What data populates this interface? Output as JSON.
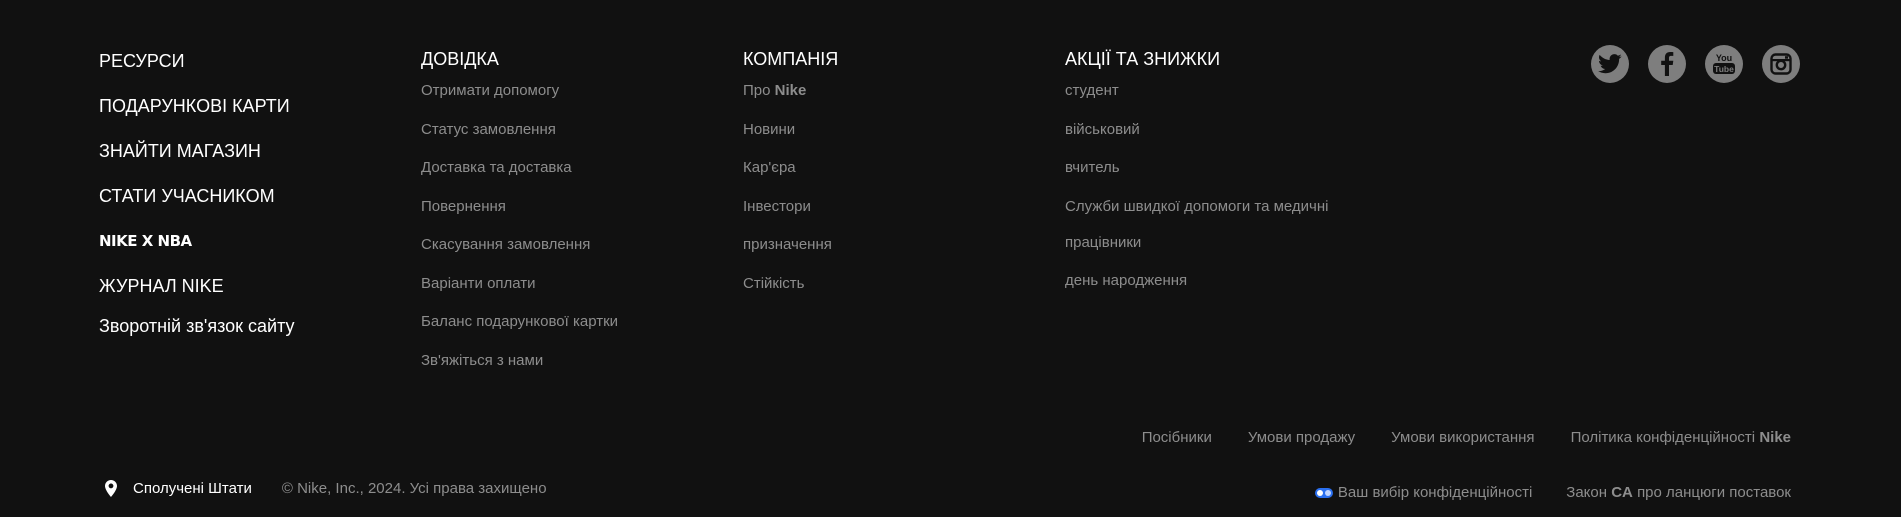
{
  "resources": {
    "items": [
      "РЕСУРСИ",
      "ПОДАРУНКОВІ КАРТИ",
      "ЗНАЙТИ МАГАЗИН",
      "СТАТИ УЧАСНИКОМ",
      "NIKE X NBA",
      "ЖУРНАЛ NIKE",
      "Зворотній зв'язок сайту"
    ]
  },
  "help": {
    "title": "ДОВІДКА",
    "items": [
      "Отримати допомогу",
      "Статус замовлення",
      "Доставка та доставка",
      "Повернення",
      "Скасування замовлення",
      "Варіанти оплати",
      "Баланс подарункової картки",
      "Зв'яжіться з нами"
    ]
  },
  "company": {
    "title": "КОМПАНІЯ",
    "about_prefix": "Про",
    "about_brand": "Nike",
    "items": [
      "Новини",
      "Кар'єра",
      "Інвестори",
      "призначення",
      "Стійкість"
    ]
  },
  "promos": {
    "title": "АКЦІЇ ТА ЗНИЖКИ",
    "items": [
      "студент",
      "військовий",
      "вчитель",
      "Служби швидкої допомоги та медичні працівники",
      "день народження"
    ]
  },
  "social": {
    "icons": [
      "twitter-icon",
      "facebook-icon",
      "youtube-icon",
      "instagram-icon"
    ],
    "youtube_text_top": "You",
    "youtube_text_bottom": "Tube"
  },
  "legal": {
    "guides": "Посібники",
    "terms_of_sale": "Умови продажу",
    "terms_of_use": "Умови використання",
    "privacy_prefix": "Політика конфіденційності",
    "privacy_brand": "Nike"
  },
  "footer": {
    "location": "Сполучені Штати",
    "copyright": "© Nike, Inc., 2024. Усі права захищено",
    "privacy_choice": "Ваш вибір конфіденційності",
    "supply_prefix": "Закон",
    "supply_bold": "CA",
    "supply_suffix": "про ланцюги поставок"
  },
  "colors": {
    "background": "#111111",
    "primary_text": "#ffffff",
    "secondary_text": "#8d8d8d",
    "icon_circle": "#7e7e7e",
    "toggle_accent": "#2a6ff0"
  }
}
